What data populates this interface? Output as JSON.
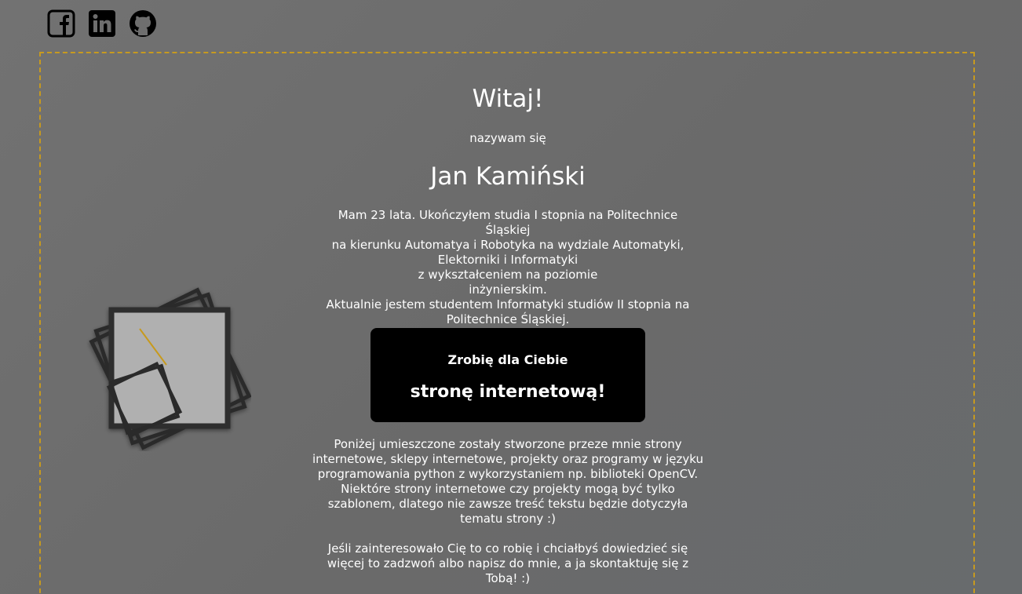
{
  "social": {
    "icons": [
      "facebook-icon",
      "linkedin-icon",
      "github-icon"
    ]
  },
  "hero": {
    "greeting": "Witaj!",
    "intro": "nazywam się",
    "name": "Jan Kamiński",
    "bio_lines": [
      "Mam 23 lata. Ukończyłem studia I stopnia na Politechnice Śląskiej",
      "na kierunku Automatya i Robotyka na wydziale Automatyki,",
      "Elektorniki i Informatyki",
      "z wykształceniem na poziomie",
      "inżynierskim.",
      "Aktualnie jestem studentem Informatyki studiów II stopnia na",
      "Politechnice Śląskiej."
    ]
  },
  "cta": {
    "small": "Zrobię dla Ciebie",
    "big": "stronę internetową!"
  },
  "description": {
    "paragraph1": "Poniżej umieszczone zostały stworzone przeze mnie strony internetowe, sklepy internetowe, projekty oraz programy w języku programowania python z wykorzystaniem np. biblioteki OpenCV. Niektóre strony internetowe czy projekty mogą być tylko szablonem, dlatego nie zawsze treść tekstu będzie dotyczyła tematu strony :)",
    "paragraph2": "Jeśli zainteresowało Cię to co robię i chciałbyś dowiedzieć się więcej to zadzwoń albo napisz do mnie, a ja skontaktuję się z Tobą! :)"
  },
  "colors": {
    "accent": "#c79a1f",
    "background": "#6e6e6e",
    "cta_background": "#000000",
    "text": "#ffffff"
  }
}
